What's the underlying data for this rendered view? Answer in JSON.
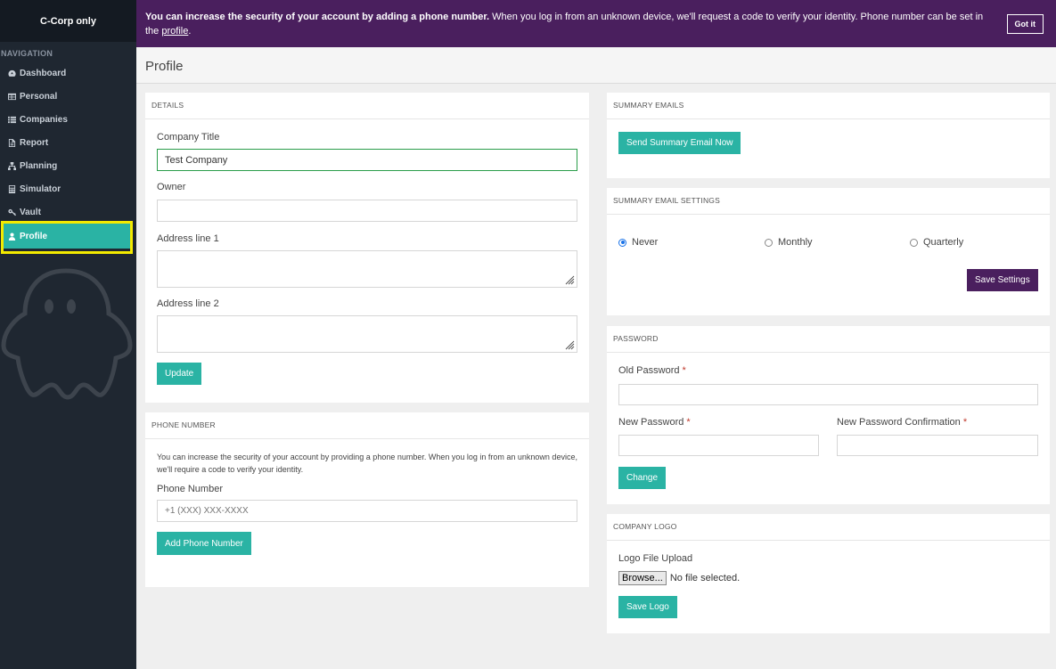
{
  "sidebar": {
    "brand": "C-Corp only",
    "nav_header": "NAVIGATION",
    "items": [
      {
        "label": "Dashboard",
        "icon": "dashboard-icon"
      },
      {
        "label": "Personal",
        "icon": "table-icon"
      },
      {
        "label": "Companies",
        "icon": "list-icon"
      },
      {
        "label": "Report",
        "icon": "report-icon"
      },
      {
        "label": "Planning",
        "icon": "sitemap-icon"
      },
      {
        "label": "Simulator",
        "icon": "calculator-icon"
      },
      {
        "label": "Vault",
        "icon": "key-icon"
      },
      {
        "label": "Profile",
        "icon": "user-icon",
        "active": true
      }
    ]
  },
  "banner": {
    "bold_text": "You can increase the security of your account by adding a phone number.",
    "text": " When you log in from an unknown device, we'll request a code to verify your identity. Phone number can be set in the ",
    "link": "profile",
    "end": ".",
    "button": "Got it"
  },
  "page_title": "Profile",
  "details": {
    "heading": "DETAILS",
    "company_title_label": "Company Title",
    "company_title_value": "Test Company",
    "owner_label": "Owner",
    "owner_value": "",
    "address1_label": "Address line 1",
    "address2_label": "Address line 2",
    "update_button": "Update"
  },
  "phone": {
    "heading": "PHONE NUMBER",
    "description": "You can increase the security of your account by providing a phone number. When you log in from an unknown device, we'll require a code to verify your identity.",
    "label": "Phone Number",
    "placeholder": "+1 (XXX) XXX-XXXX",
    "button": "Add Phone Number"
  },
  "summary_emails": {
    "heading": "SUMMARY EMAILS",
    "button": "Send Summary Email Now"
  },
  "summary_settings": {
    "heading": "SUMMARY EMAIL SETTINGS",
    "options": [
      "Never",
      "Monthly",
      "Quarterly"
    ],
    "selected": "Never",
    "button": "Save Settings"
  },
  "password": {
    "heading": "PASSWORD",
    "old_label": "Old Password",
    "new_label": "New Password",
    "confirm_label": "New Password Confirmation",
    "required_mark": "*",
    "button": "Change"
  },
  "logo": {
    "heading": "COMPANY LOGO",
    "label": "Logo File Upload",
    "browse": "Browse...",
    "no_file": "No file selected.",
    "button": "Save Logo"
  },
  "colors": {
    "sidebar": "#1f2731",
    "accent": "#2ab3a4",
    "banner": "#4a1f5e",
    "highlight": "#f4ea00"
  }
}
